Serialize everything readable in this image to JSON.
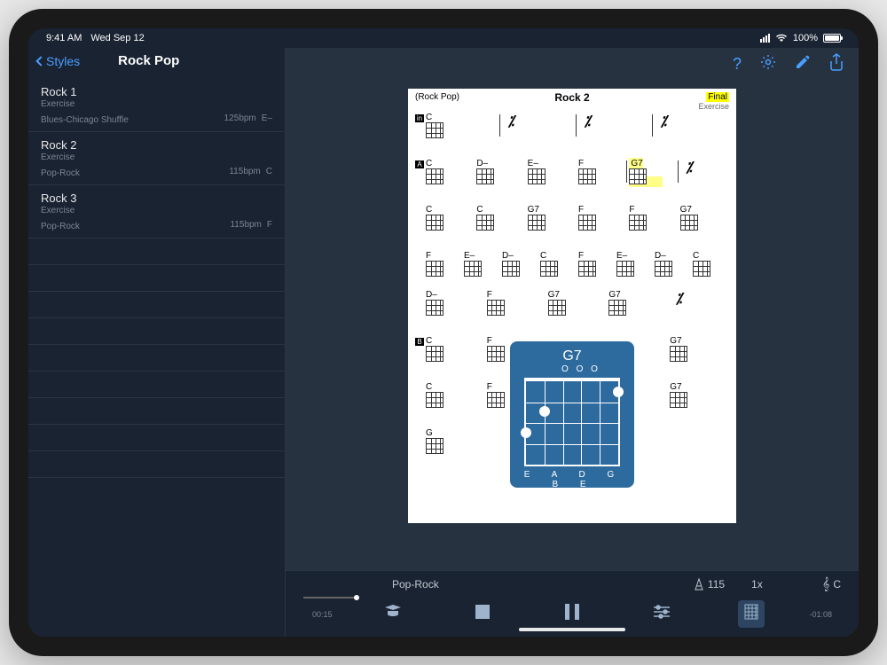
{
  "status": {
    "time": "9:41 AM",
    "date": "Wed Sep 12",
    "battery": "100%"
  },
  "sidebar": {
    "back": "Styles",
    "title": "Rock Pop",
    "songs": [
      {
        "name": "Rock 1",
        "sub": "Exercise",
        "style": "Blues-Chicago Shuffle",
        "tempo": "125",
        "tempo_unit": "bpm",
        "key": "E–"
      },
      {
        "name": "Rock 2",
        "sub": "Exercise",
        "style": "Pop-Rock",
        "tempo": "115",
        "tempo_unit": "bpm",
        "key": "C"
      },
      {
        "name": "Rock 3",
        "sub": "Exercise",
        "style": "Pop-Rock",
        "tempo": "115",
        "tempo_unit": "bpm",
        "key": "F"
      }
    ]
  },
  "sheet": {
    "style_label": "(Rock Pop)",
    "title": "Rock 2",
    "final": "Final",
    "exercise": "Exercise",
    "rows": [
      {
        "marker": "in",
        "cells": [
          "C",
          "/",
          "/",
          "/"
        ]
      },
      {
        "marker": "A",
        "cells": [
          "C",
          "D–",
          "E–",
          "F",
          "G7",
          "/"
        ]
      },
      {
        "marker": "",
        "cells": [
          "C",
          "C",
          "G7",
          "F",
          "F",
          "G7"
        ]
      },
      {
        "marker": "",
        "cells": [
          "F",
          "E–",
          "D–",
          "C",
          "F",
          "E–",
          "D–",
          "C"
        ]
      },
      {
        "marker": "",
        "cells": [
          "D–",
          "F",
          "G7",
          "G7",
          "/"
        ]
      },
      {
        "marker": "B",
        "cells": [
          "C",
          "F",
          "",
          "",
          "G7"
        ]
      },
      {
        "marker": "",
        "cells": [
          "C",
          "F",
          "",
          "",
          "G7"
        ]
      },
      {
        "marker": "",
        "cells": [
          "G",
          "",
          "",
          "",
          ""
        ]
      }
    ]
  },
  "overlay": {
    "name": "G7",
    "open": "O O O",
    "strings": "E A D G B E"
  },
  "player": {
    "name": "Pop-Rock",
    "tempo": "115",
    "speed": "1x",
    "key": "C",
    "time_cur": "00:15",
    "time_rem": "-01:08"
  }
}
